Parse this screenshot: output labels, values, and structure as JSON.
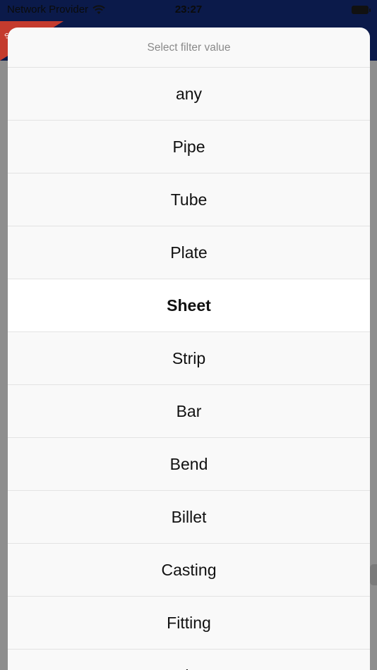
{
  "status": {
    "carrier": "Network Provider",
    "time": "23:27"
  },
  "header": {
    "badge_text": "Spec"
  },
  "picker": {
    "title": "Select filter value",
    "selected": "Sheet",
    "options": [
      "any",
      "Pipe",
      "Tube",
      "Plate",
      "Sheet",
      "Strip",
      "Bar",
      "Bend",
      "Billet",
      "Casting",
      "Fitting",
      "Fl..."
    ]
  }
}
